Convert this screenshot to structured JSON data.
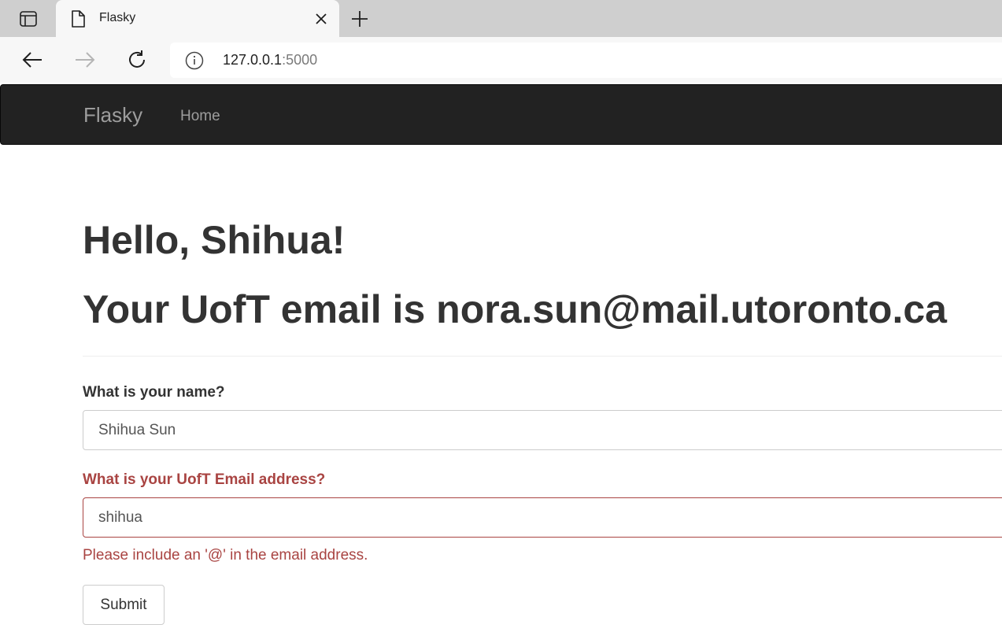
{
  "browser": {
    "tab": {
      "title": "Flasky"
    },
    "address": {
      "host": "127.0.0.1",
      "port": ":5000"
    },
    "icons": {
      "tab_actions": "tab-actions-icon",
      "favicon": "page-icon",
      "close": "close-icon",
      "new_tab": "plus-icon",
      "back": "arrow-left-icon",
      "forward": "arrow-right-icon",
      "reload": "reload-icon",
      "site_info": "info-icon"
    }
  },
  "navbar": {
    "brand": "Flasky",
    "links": [
      {
        "label": "Home"
      }
    ]
  },
  "page": {
    "greeting": "Hello, Shihua!",
    "email_line": "Your UofT email is nora.sun@mail.utoronto.ca"
  },
  "form": {
    "name_label": "What is your name?",
    "name_value": "Shihua Sun",
    "email_label": "What is your UofT Email address?",
    "email_value": "shihua",
    "email_error": "Please include an '@' in the email address.",
    "submit_label": "Submit"
  },
  "colors": {
    "navbar_bg": "#222222",
    "navbar_text": "#9d9d9d",
    "error": "#a94442",
    "heading_text": "#333333"
  }
}
